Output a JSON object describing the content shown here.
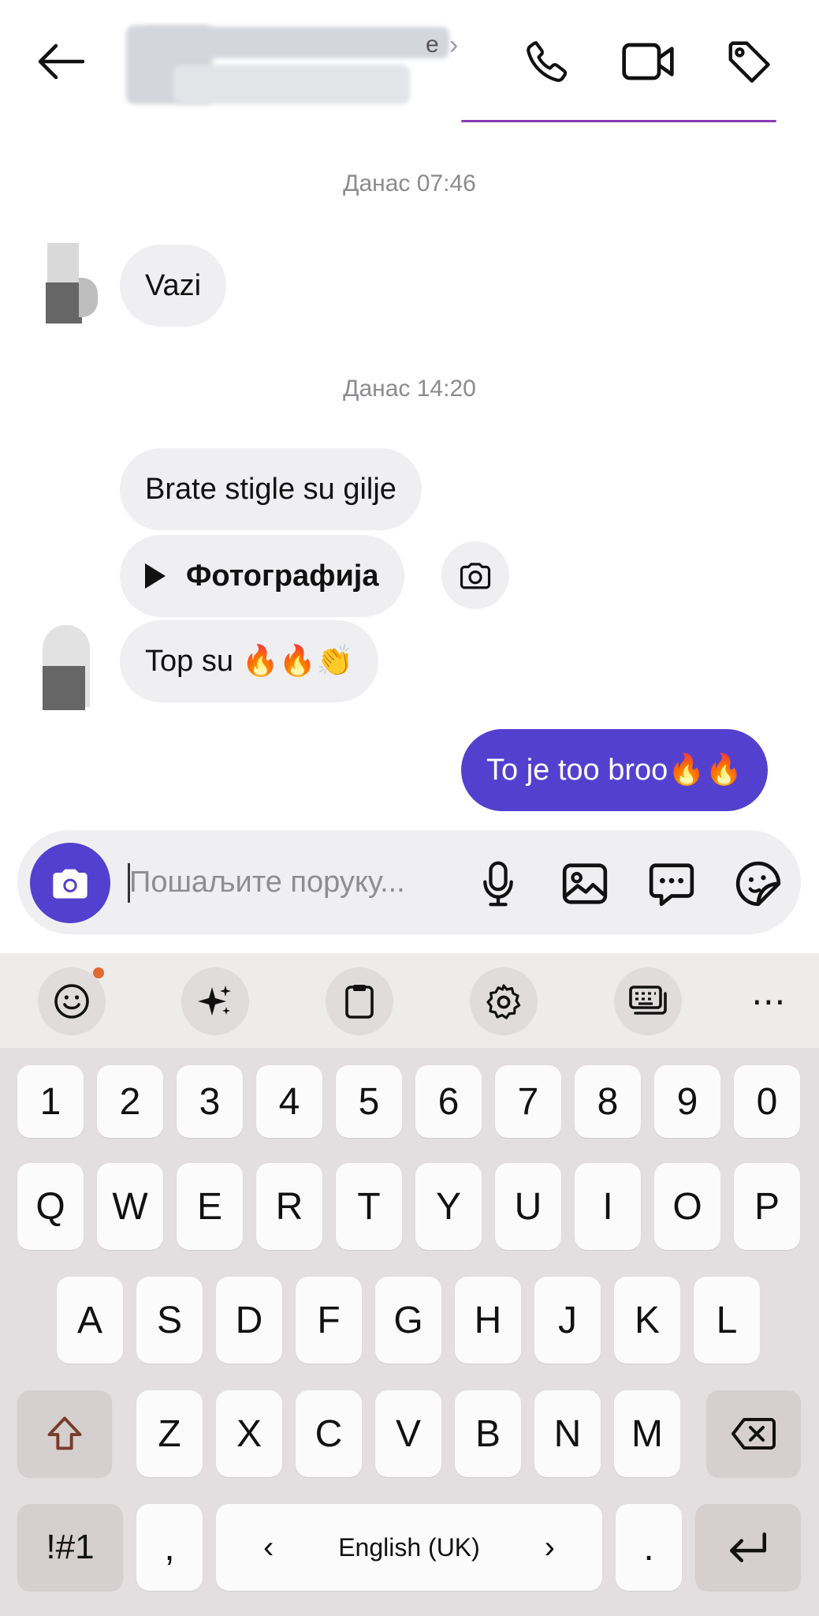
{
  "header": {
    "back_icon": "arrow-left-icon",
    "contact_name_partial": "e",
    "chevron": "›",
    "icons": [
      "phone-icon",
      "video-icon",
      "tag-icon"
    ],
    "accent": "#8a3bb3"
  },
  "chat": {
    "timestamp_1": "Данас 07:46",
    "timestamp_2": "Данас 14:20",
    "msg_vazi": "Vazi",
    "msg_gilje": "Brate stigle su gilje",
    "msg_photo": "Фотографија",
    "msg_top": "Top su 🔥🔥👏",
    "msg_out": "To je too broo🔥🔥",
    "out_color": "#5440cf"
  },
  "composer": {
    "placeholder": "Пошаљите поруку...",
    "icons": [
      "camera-icon",
      "microphone-icon",
      "gallery-icon",
      "chat-bubble-icon",
      "sticker-icon"
    ]
  },
  "keyboard": {
    "toolbar": [
      "emoji-icon",
      "sparkle-icon",
      "clipboard-icon",
      "settings-icon",
      "keyboard-mode-icon",
      "more-icon"
    ],
    "more": "⋯",
    "row_numbers": [
      "1",
      "2",
      "3",
      "4",
      "5",
      "6",
      "7",
      "8",
      "9",
      "0"
    ],
    "row_1": [
      "Q",
      "W",
      "E",
      "R",
      "T",
      "Y",
      "U",
      "I",
      "O",
      "P"
    ],
    "row_2": [
      "A",
      "S",
      "D",
      "F",
      "G",
      "H",
      "J",
      "K",
      "L"
    ],
    "row_3": [
      "Z",
      "X",
      "C",
      "V",
      "B",
      "N",
      "M"
    ],
    "symbols_key": "!#1",
    "comma_key": ",",
    "space_label": "English (UK)",
    "space_left": "‹",
    "space_right": "›",
    "period_key": "."
  }
}
